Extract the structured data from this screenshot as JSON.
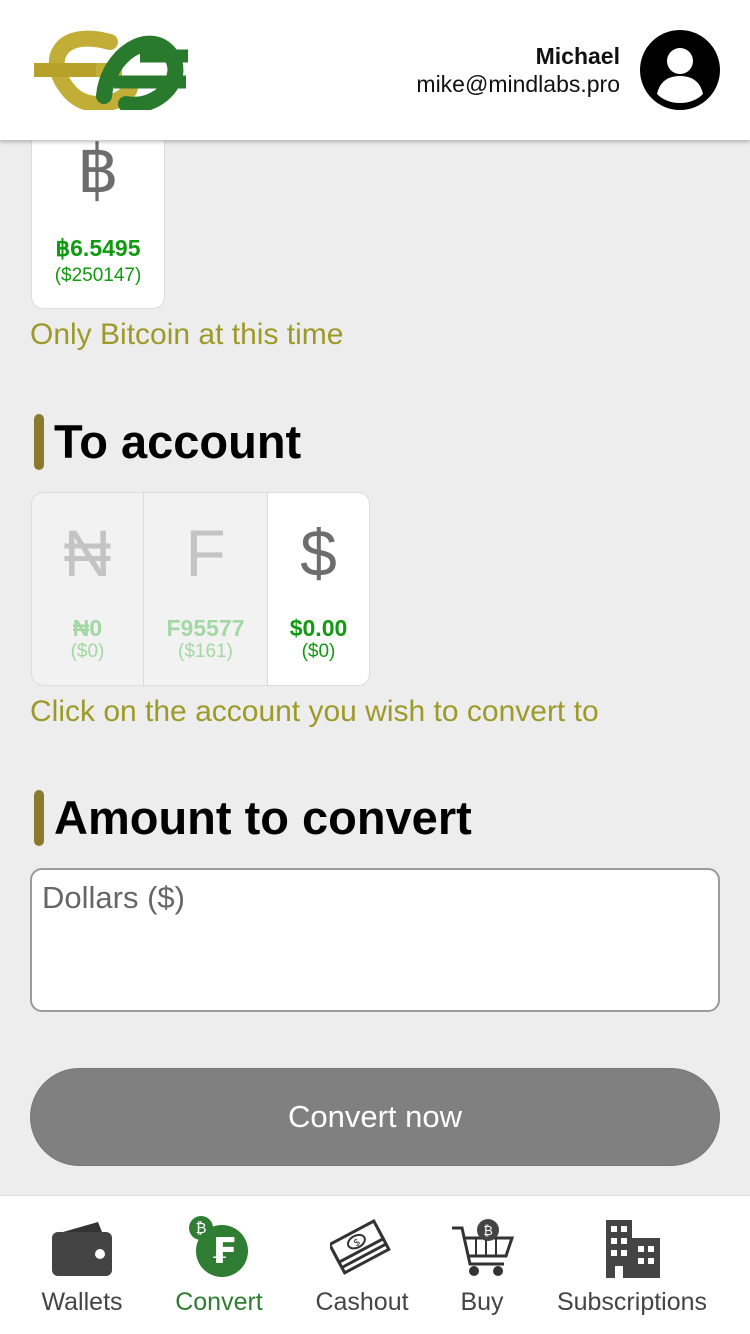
{
  "header": {
    "user_name": "Michael",
    "user_email": "mike@mindlabs.pro",
    "logo_icon": "logo-icon",
    "avatar_icon": "user-avatar-icon"
  },
  "from_account": {
    "symbol": "฿",
    "amount": "฿6.5495",
    "usd": "($250147)",
    "note": "Only Bitcoin at this time"
  },
  "to_account": {
    "title": "To account",
    "accounts": [
      {
        "symbol": "₦",
        "amount": "₦0",
        "usd": "($0)",
        "state": "dim"
      },
      {
        "symbol": "F",
        "amount": "F95577",
        "usd": "($161)",
        "state": "dim"
      },
      {
        "symbol": "$",
        "amount": "$0.00",
        "usd": "($0)",
        "state": "selected"
      }
    ],
    "note": "Click on the account you wish to convert to"
  },
  "amount": {
    "title": "Amount to convert",
    "placeholder": "Dollars ($)",
    "value": ""
  },
  "convert_button": {
    "label": "Convert now"
  },
  "nav": {
    "items": [
      {
        "label": "Wallets",
        "icon": "wallet-icon",
        "active": false
      },
      {
        "label": "Convert",
        "icon": "convert-icon",
        "active": true
      },
      {
        "label": "Cashout",
        "icon": "cashout-icon",
        "active": false
      },
      {
        "label": "Buy",
        "icon": "cart-icon",
        "active": false
      },
      {
        "label": "Subscriptions",
        "icon": "building-icon",
        "active": false
      }
    ]
  },
  "colors": {
    "accent_green": "#0f9a0f",
    "note_olive": "#9d9a2a",
    "title_bar": "#8a7a2e",
    "nav_active": "#2e7d32",
    "button_gray": "#808080"
  }
}
